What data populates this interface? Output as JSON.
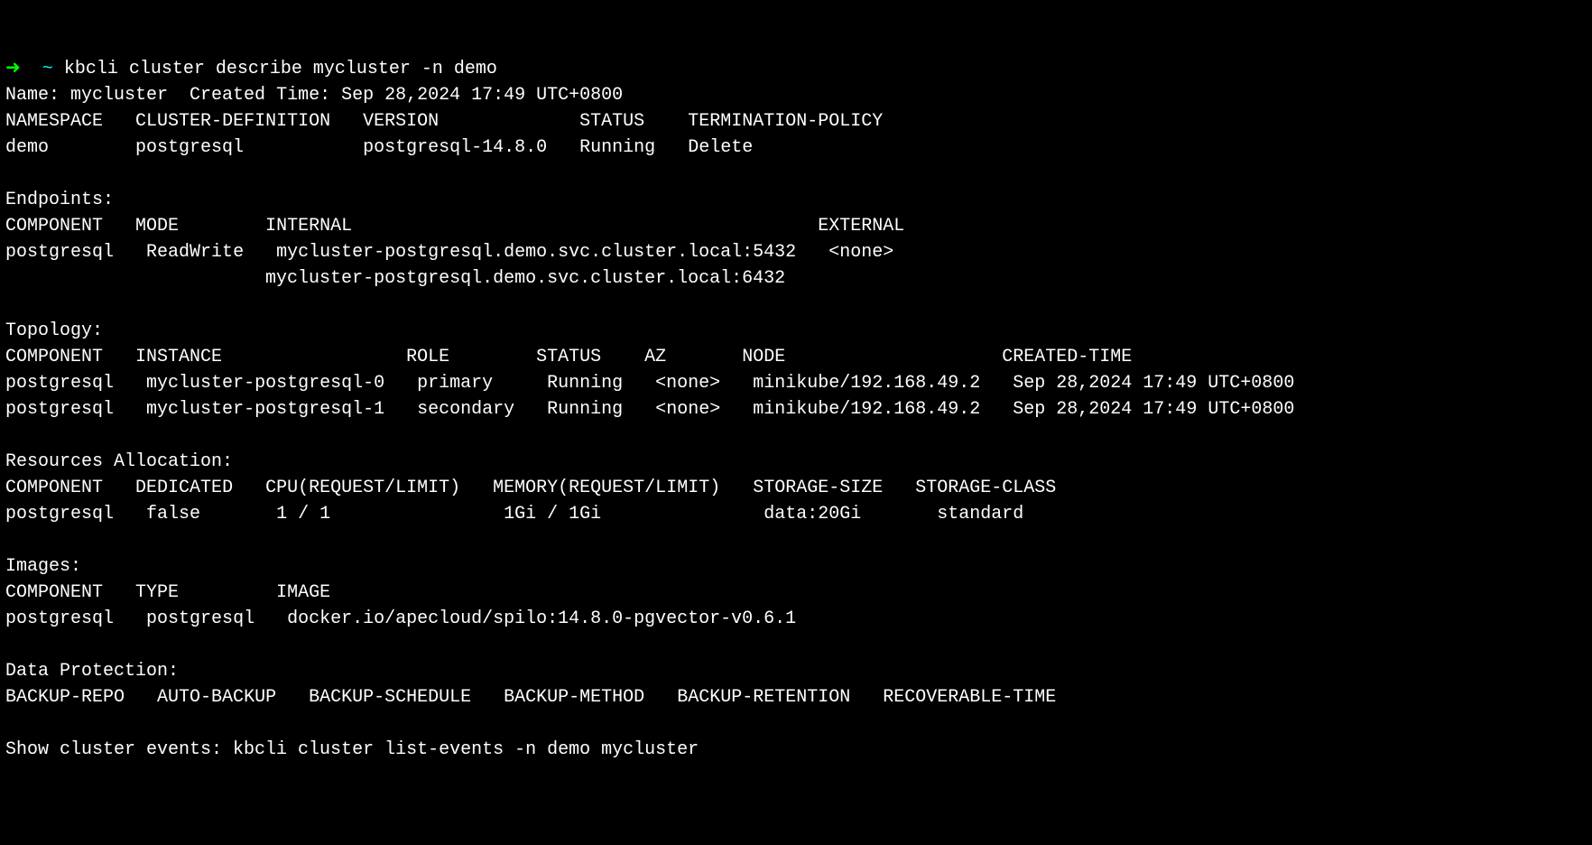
{
  "prompt": {
    "arrow": "➜",
    "tilde": "~",
    "command": "kbcli cluster describe mycluster -n demo"
  },
  "header": {
    "name_label": "Name:",
    "name_value": "mycluster",
    "created_label": "Created Time:",
    "created_value": "Sep 28,2024 17:49 UTC+0800"
  },
  "summary": {
    "headers": {
      "namespace": "NAMESPACE",
      "cluster_def": "CLUSTER-DEFINITION",
      "version": "VERSION",
      "status": "STATUS",
      "termination": "TERMINATION-POLICY"
    },
    "row": {
      "namespace": "demo",
      "cluster_def": "postgresql",
      "version": "postgresql-14.8.0",
      "status": "Running",
      "termination": "Delete"
    }
  },
  "endpoints": {
    "title": "Endpoints:",
    "headers": {
      "component": "COMPONENT",
      "mode": "MODE",
      "internal": "INTERNAL",
      "external": "EXTERNAL"
    },
    "row": {
      "component": "postgresql",
      "mode": "ReadWrite",
      "internal1": "mycluster-postgresql.demo.svc.cluster.local:5432",
      "internal2": "mycluster-postgresql.demo.svc.cluster.local:6432",
      "external": "<none>"
    }
  },
  "topology": {
    "title": "Topology:",
    "headers": {
      "component": "COMPONENT",
      "instance": "INSTANCE",
      "role": "ROLE",
      "status": "STATUS",
      "az": "AZ",
      "node": "NODE",
      "created": "CREATED-TIME"
    },
    "rows": [
      {
        "component": "postgresql",
        "instance": "mycluster-postgresql-0",
        "role": "primary",
        "status": "Running",
        "az": "<none>",
        "node": "minikube/192.168.49.2",
        "created": "Sep 28,2024 17:49 UTC+0800"
      },
      {
        "component": "postgresql",
        "instance": "mycluster-postgresql-1",
        "role": "secondary",
        "status": "Running",
        "az": "<none>",
        "node": "minikube/192.168.49.2",
        "created": "Sep 28,2024 17:49 UTC+0800"
      }
    ]
  },
  "resources": {
    "title": "Resources Allocation:",
    "headers": {
      "component": "COMPONENT",
      "dedicated": "DEDICATED",
      "cpu": "CPU(REQUEST/LIMIT)",
      "memory": "MEMORY(REQUEST/LIMIT)",
      "storage_size": "STORAGE-SIZE",
      "storage_class": "STORAGE-CLASS"
    },
    "row": {
      "component": "postgresql",
      "dedicated": "false",
      "cpu": "1 / 1",
      "memory": "1Gi / 1Gi",
      "storage_size": "data:20Gi",
      "storage_class": "standard"
    }
  },
  "images": {
    "title": "Images:",
    "headers": {
      "component": "COMPONENT",
      "type": "TYPE",
      "image": "IMAGE"
    },
    "row": {
      "component": "postgresql",
      "type": "postgresql",
      "image": "docker.io/apecloud/spilo:14.8.0-pgvector-v0.6.1"
    }
  },
  "data_protection": {
    "title": "Data Protection:",
    "headers": {
      "backup_repo": "BACKUP-REPO",
      "auto_backup": "AUTO-BACKUP",
      "backup_schedule": "BACKUP-SCHEDULE",
      "backup_method": "BACKUP-METHOD",
      "backup_retention": "BACKUP-RETENTION",
      "recoverable_time": "RECOVERABLE-TIME"
    }
  },
  "footer": {
    "text": "Show cluster events: kbcli cluster list-events -n demo mycluster"
  }
}
